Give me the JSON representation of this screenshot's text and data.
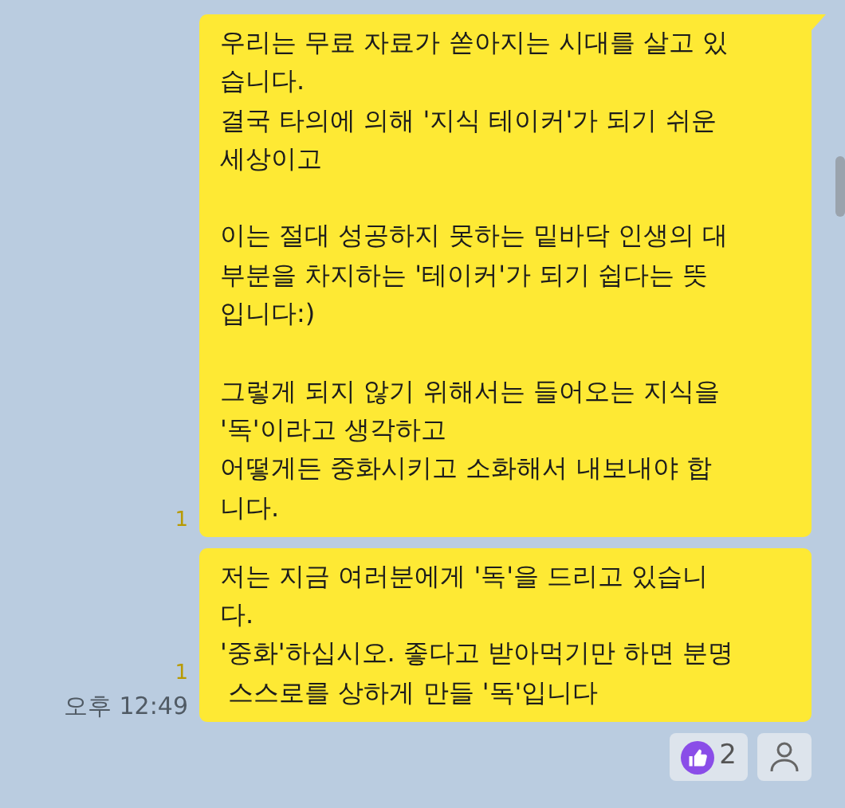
{
  "messages": [
    {
      "text": "우리는 무료 자료가 쏟아지는 시대를 살고 있\n습니다.\n결국 타의에 의해 '지식 테이커'가 되기 쉬운\n세상이고\n\n이는 절대 성공하지 못하는 밑바닥 인생의 대\n부분을 차지하는 '테이커'가 되기 쉽다는 뜻\n입니다:)\n\n그렇게 되지 않기 위해서는 들어오는 지식을\n'독'이라고 생각하고\n어떻게든 중화시키고 소화해서 내보내야 합\n니다.",
      "unread": "1",
      "tail": true
    },
    {
      "text": "저는 지금 여러분에게 '독'을 드리고 있습니\n다.\n'중화'하십시오. 좋다고 받아먹기만 하면 분명\n 스스로를 상하게 만들 '독'입니다",
      "unread": "1",
      "time": "오후 12:49",
      "tail": false
    }
  ],
  "reactions": {
    "like_count": "2"
  }
}
